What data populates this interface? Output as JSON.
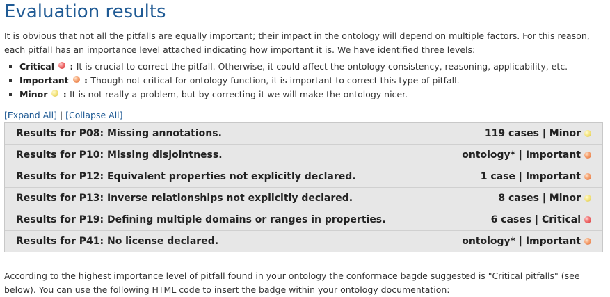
{
  "title": "Evaluation results",
  "intro": "It is obvious that not all the pitfalls are equally important; their impact in the ontology will depend on multiple factors. For this reason, each pitfall has an importance level attached indicating how important it is. We have identified three levels:",
  "levels": [
    {
      "name": "Critical",
      "icon": "red-dot-icon",
      "sep": " : ",
      "desc": "It is crucial to correct the pitfall. Otherwise, it could affect the ontology consistency, reasoning, applicability, etc."
    },
    {
      "name": "Important",
      "icon": "orange-dot-icon",
      "sep": " : ",
      "desc": "Though not critical for ontology function, it is important to correct this type of pitfall."
    },
    {
      "name": "Minor",
      "icon": "yellow-dot-icon",
      "sep": " : ",
      "desc": "It is not really a problem, but by correcting it we will make the ontology nicer."
    }
  ],
  "controls": {
    "expand_all": "[Expand All]",
    "separator": "|",
    "collapse_all": "[Collapse All]"
  },
  "results": [
    {
      "label": "Results for P08: Missing annotations.",
      "count": "119 cases | Minor",
      "level": "minor"
    },
    {
      "label": "Results for P10: Missing disjointness.",
      "count": "ontology* | Important",
      "level": "important"
    },
    {
      "label": "Results for P12: Equivalent properties not explicitly declared.",
      "count": "1 case | Important",
      "level": "important"
    },
    {
      "label": "Results for P13: Inverse relationships not explicitly declared.",
      "count": "8 cases | Minor",
      "level": "minor"
    },
    {
      "label": "Results for P19: Defining multiple domains or ranges in properties.",
      "count": "6 cases | Critical",
      "level": "critical"
    },
    {
      "label": "Results for P41: No license declared.",
      "count": "ontology* | Important",
      "level": "important"
    }
  ],
  "outro": "According to the highest importance level of pitfall found in your ontology the conformace bagde suggested is \"Critical pitfalls\" (see below). You can use the following HTML code to insert the badge within your ontology documentation:",
  "colors": {
    "title": "#1f5a94",
    "link": "#1f5a94",
    "panel_bg": "#e7e7e7",
    "critical": "#e05050",
    "important": "#f08a50",
    "minor": "#f0dc70"
  }
}
